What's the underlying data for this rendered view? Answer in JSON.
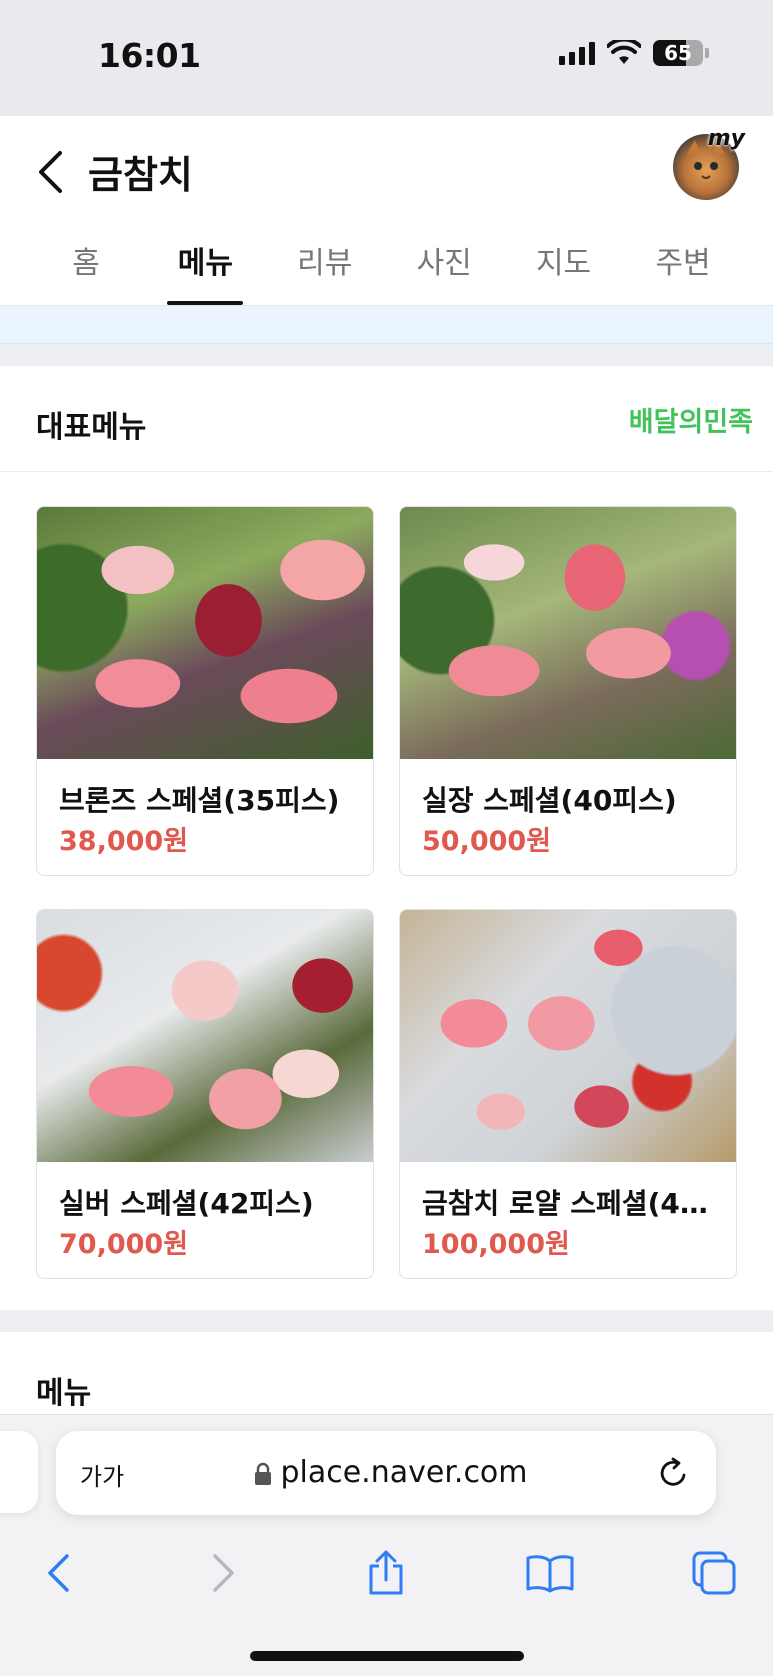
{
  "status_bar": {
    "time": "16:01",
    "battery": "65"
  },
  "header": {
    "title": "금참치",
    "avatar_label": "my"
  },
  "tabs": [
    {
      "label": "홈",
      "active": false
    },
    {
      "label": "메뉴",
      "active": true
    },
    {
      "label": "리뷰",
      "active": false
    },
    {
      "label": "사진",
      "active": false
    },
    {
      "label": "지도",
      "active": false
    },
    {
      "label": "주변",
      "active": false
    }
  ],
  "representative_menu": {
    "title": "대표메뉴",
    "partner_link": "배달의민족",
    "items": [
      {
        "name": "브론즈 스페셜(35피스)",
        "price": "38,000원"
      },
      {
        "name": "실장 스페셜(40피스)",
        "price": "50,000원"
      },
      {
        "name": "실버 스페셜(42피스)",
        "price": "70,000원"
      },
      {
        "name": "금참치 로얄 스페셜(4…",
        "price": "100,000원"
      }
    ]
  },
  "menu_section": {
    "title": "메뉴"
  },
  "browser": {
    "text_size_label": "가가",
    "url": "place.naver.com"
  },
  "colors": {
    "price_red": "#e0584e",
    "baemin_green": "#42c25a",
    "safari_blue": "#2f7cf6"
  }
}
